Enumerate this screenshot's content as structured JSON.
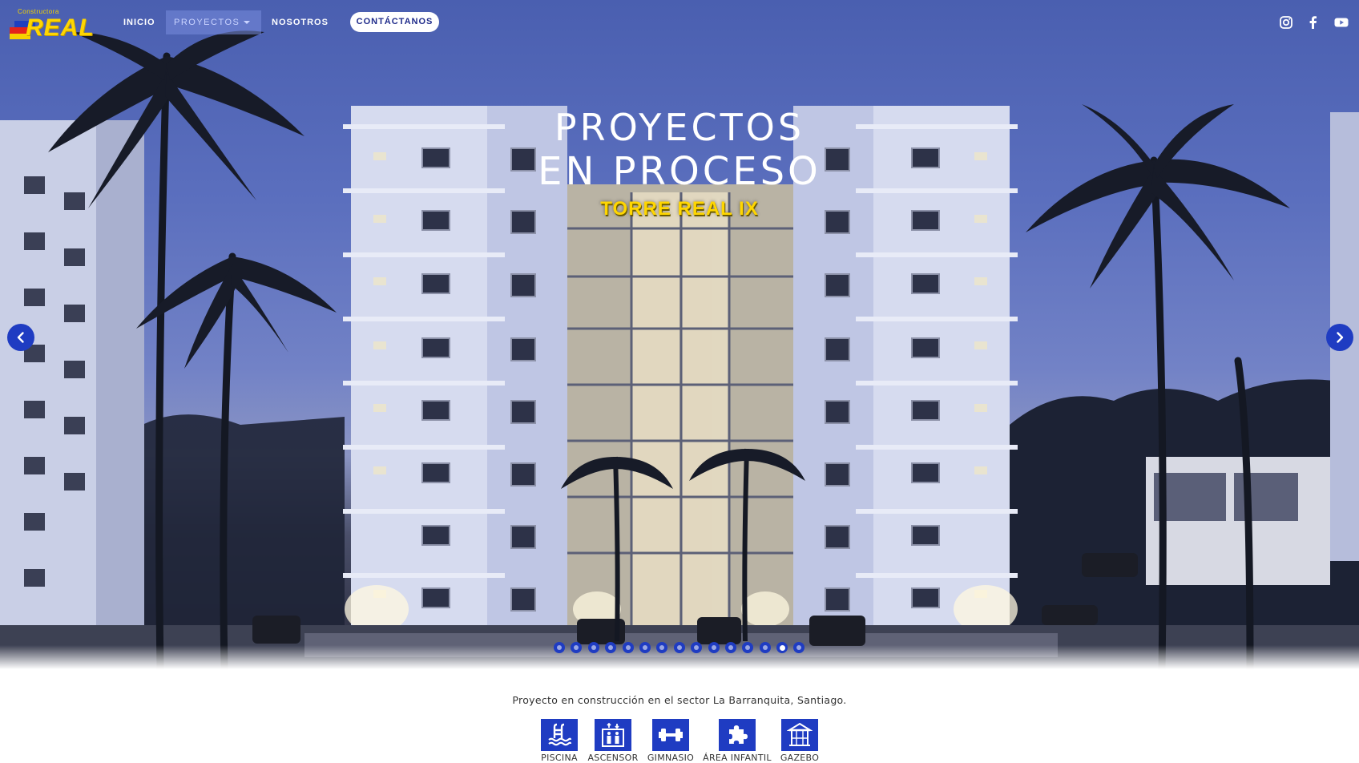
{
  "brand": {
    "logo_small": "Constructora",
    "logo_word": "REAL"
  },
  "nav": {
    "inicio": "INICIO",
    "proyectos": "PROYECTOS",
    "nosotros": "NOSOTROS",
    "contact": "CONTÁCTANOS"
  },
  "social": [
    "instagram-icon",
    "facebook-icon",
    "youtube-icon"
  ],
  "hero": {
    "title_line1": "PROYECTOS",
    "title_line2": "EN PROCESO",
    "subtitle": "TORRE REAL IX",
    "slide_count": 15,
    "active_slide": 14
  },
  "description": "Proyecto en construcción en el sector La Barranquita, Santiago.",
  "amenities": [
    {
      "label": "PISCINA",
      "icon": "pool-icon"
    },
    {
      "label": "ASCENSOR",
      "icon": "elevator-icon"
    },
    {
      "label": "GIMNASIO",
      "icon": "gym-icon"
    },
    {
      "label": "ÁREA INFANTIL",
      "icon": "puzzle-icon"
    },
    {
      "label": "GAZEBO",
      "icon": "gazebo-icon"
    }
  ],
  "colors": {
    "accent": "#1f3cc2",
    "brand_yellow": "#ffd600",
    "sky": "#5b6fbe"
  }
}
